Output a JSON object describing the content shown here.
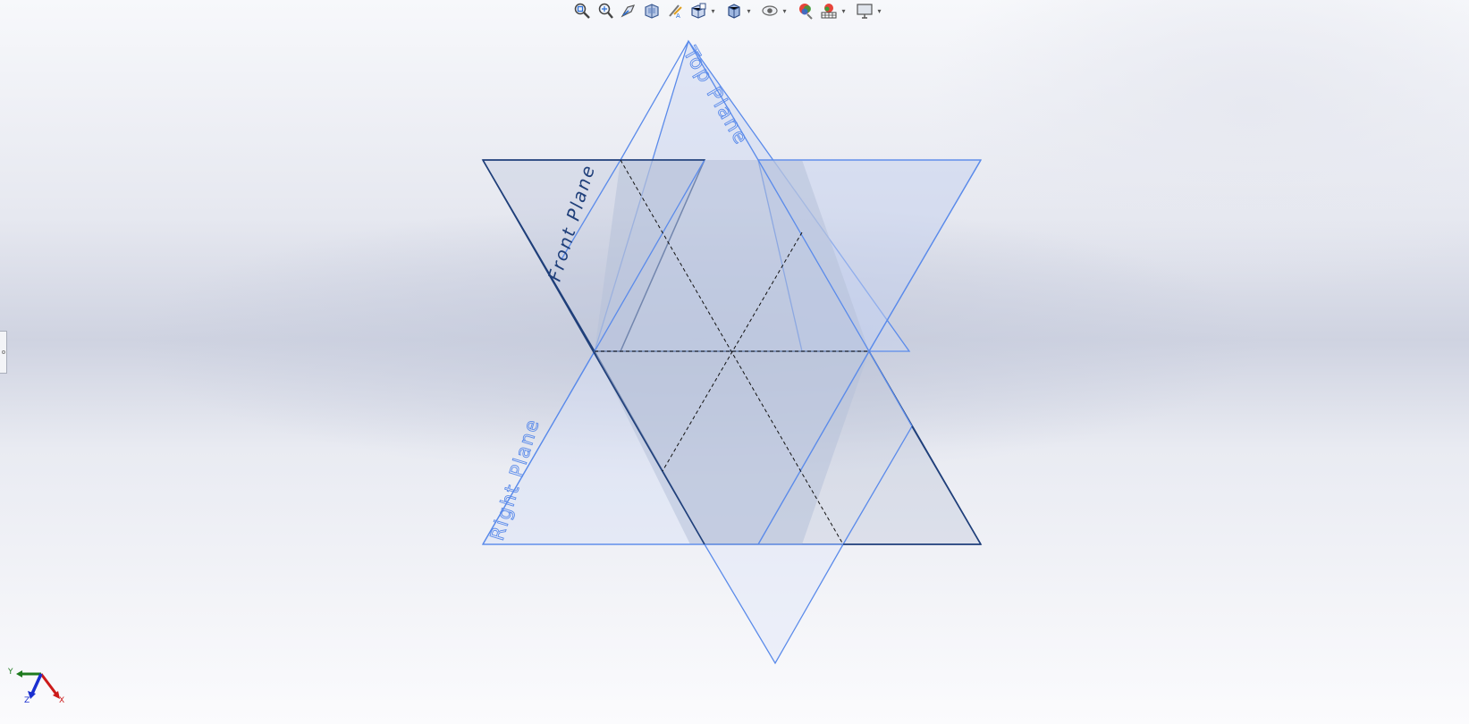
{
  "planes": {
    "top": "Top Plane",
    "front": "Front Plane",
    "right": "Right Plane"
  },
  "triad": {
    "x": "X",
    "y": "Y",
    "z": "Z"
  },
  "toolbar": {
    "buttons": [
      "zoom-to-fit-icon",
      "zoom-to-area-icon",
      "previous-view-icon",
      "section-view-icon",
      "dynamic-annotation-views-icon",
      "view-orientation-icon",
      "display-style-icon",
      "hide-show-items-icon",
      "edit-appearance-icon",
      "apply-scene-icon",
      "view-settings-icon"
    ]
  },
  "colors": {
    "top_plane_edge": "#5b8bea",
    "front_plane_edge": "#1f3f7a",
    "plane_fill": "#c6d2ef",
    "triad_x": "#cc1a1a",
    "triad_y": "#1e7a1e",
    "triad_z": "#1a2fd0"
  }
}
